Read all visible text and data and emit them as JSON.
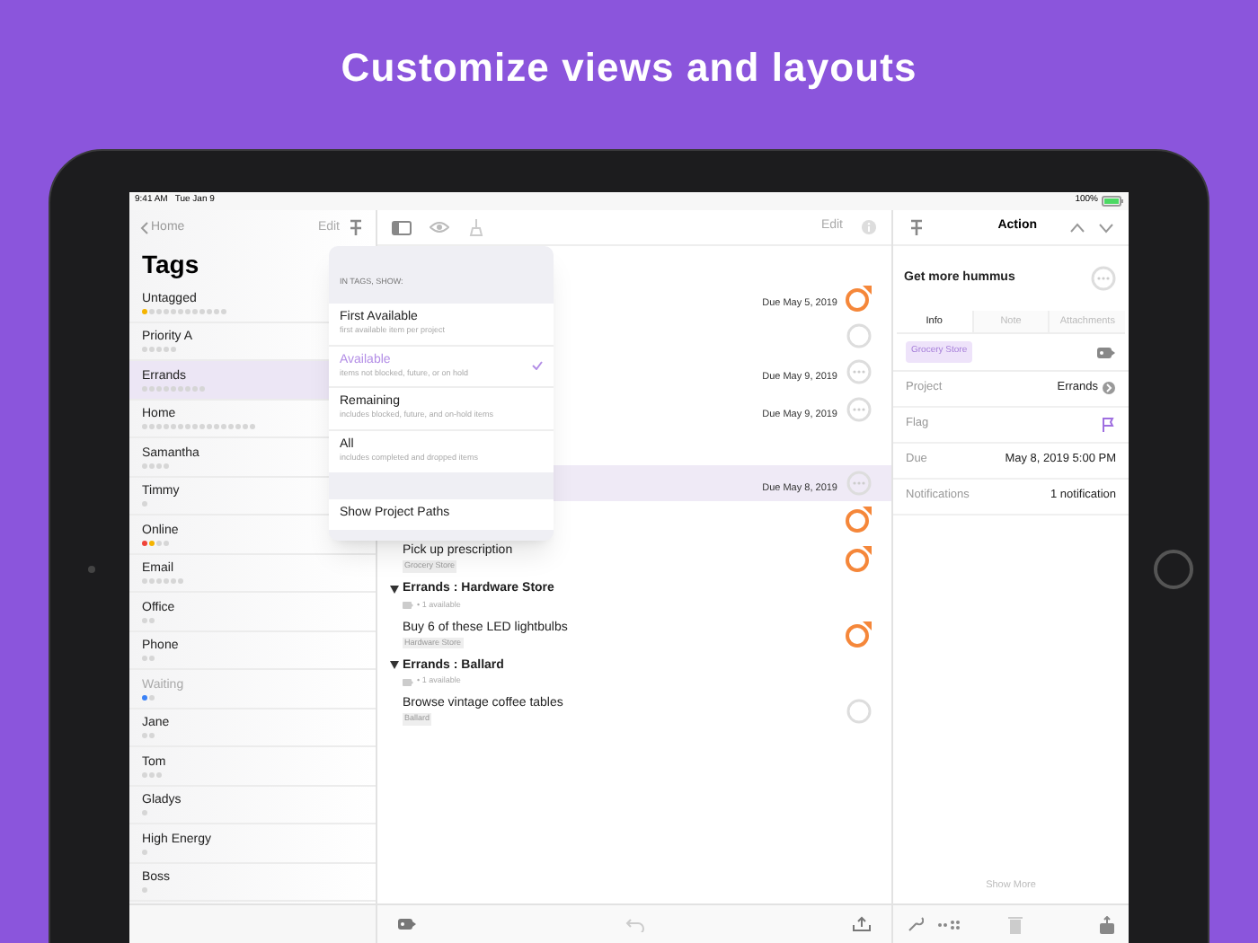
{
  "headline": "Customize views and layouts",
  "status_bar": {
    "time": "9:41 AM",
    "date": "Tue Jan 9",
    "battery": "100%"
  },
  "sidebar": {
    "back": "Home",
    "edit": "Edit",
    "title": "Tags",
    "tags": [
      {
        "name": "Untagged",
        "selected": false,
        "dimmed": false,
        "dots": [
          {
            "color": "#f5b400"
          },
          {
            "color": "#d6d6d6"
          },
          {
            "color": "#d6d6d6"
          },
          {
            "color": "#d6d6d6"
          },
          {
            "color": "#d6d6d6"
          },
          {
            "color": "#d6d6d6"
          },
          {
            "color": "#d6d6d6"
          },
          {
            "color": "#d6d6d6"
          },
          {
            "color": "#d6d6d6"
          },
          {
            "color": "#d6d6d6"
          },
          {
            "color": "#d6d6d6"
          },
          {
            "color": "#d6d6d6"
          }
        ]
      },
      {
        "name": "Priority A",
        "selected": false,
        "dimmed": false,
        "dots": [
          {
            "color": "#d6d6d6"
          },
          {
            "color": "#d6d6d6"
          },
          {
            "color": "#d6d6d6"
          },
          {
            "color": "#d6d6d6"
          },
          {
            "color": "#d6d6d6"
          }
        ]
      },
      {
        "name": "Errands",
        "selected": true,
        "dimmed": false,
        "dots": [
          {
            "color": "#d6d6d6"
          },
          {
            "color": "#d6d6d6"
          },
          {
            "color": "#d6d6d6"
          },
          {
            "color": "#d6d6d6"
          },
          {
            "color": "#d6d6d6"
          },
          {
            "color": "#d6d6d6"
          },
          {
            "color": "#d6d6d6"
          },
          {
            "color": "#d6d6d6"
          },
          {
            "color": "#d6d6d6"
          }
        ]
      },
      {
        "name": "Home",
        "selected": false,
        "dimmed": false,
        "dots": [
          {
            "color": "#d6d6d6"
          },
          {
            "color": "#d6d6d6"
          },
          {
            "color": "#d6d6d6"
          },
          {
            "color": "#d6d6d6"
          },
          {
            "color": "#d6d6d6"
          },
          {
            "color": "#d6d6d6"
          },
          {
            "color": "#d6d6d6"
          },
          {
            "color": "#d6d6d6"
          },
          {
            "color": "#d6d6d6"
          },
          {
            "color": "#d6d6d6"
          },
          {
            "color": "#d6d6d6"
          },
          {
            "color": "#d6d6d6"
          },
          {
            "color": "#d6d6d6"
          },
          {
            "color": "#d6d6d6"
          },
          {
            "color": "#d6d6d6"
          },
          {
            "color": "#d6d6d6"
          }
        ]
      },
      {
        "name": "Samantha",
        "selected": false,
        "dimmed": false,
        "dots": [
          {
            "color": "#d6d6d6"
          },
          {
            "color": "#d6d6d6"
          },
          {
            "color": "#d6d6d6"
          },
          {
            "color": "#d6d6d6"
          }
        ]
      },
      {
        "name": "Timmy",
        "selected": false,
        "dimmed": false,
        "dots": [
          {
            "color": "#d6d6d6"
          }
        ]
      },
      {
        "name": "Online",
        "selected": false,
        "dimmed": false,
        "dots": [
          {
            "color": "#f0443a"
          },
          {
            "color": "#f5b400"
          },
          {
            "color": "#d6d6d6"
          },
          {
            "color": "#d6d6d6"
          }
        ]
      },
      {
        "name": "Email",
        "selected": false,
        "dimmed": false,
        "dots": [
          {
            "color": "#d6d6d6"
          },
          {
            "color": "#d6d6d6"
          },
          {
            "color": "#d6d6d6"
          },
          {
            "color": "#d6d6d6"
          },
          {
            "color": "#d6d6d6"
          },
          {
            "color": "#d6d6d6"
          }
        ]
      },
      {
        "name": "Office",
        "selected": false,
        "dimmed": false,
        "dots": [
          {
            "color": "#d6d6d6"
          },
          {
            "color": "#d6d6d6"
          }
        ]
      },
      {
        "name": "Phone",
        "selected": false,
        "dimmed": false,
        "dots": [
          {
            "color": "#d6d6d6"
          },
          {
            "color": "#d6d6d6"
          }
        ]
      },
      {
        "name": "Waiting",
        "selected": false,
        "dimmed": true,
        "dots": [
          {
            "color": "#3b82f6"
          },
          {
            "color": "#d6d6d6"
          }
        ]
      },
      {
        "name": "Jane",
        "selected": false,
        "dimmed": false,
        "dots": [
          {
            "color": "#d6d6d6"
          },
          {
            "color": "#d6d6d6"
          }
        ]
      },
      {
        "name": "Tom",
        "selected": false,
        "dimmed": false,
        "dots": [
          {
            "color": "#d6d6d6"
          },
          {
            "color": "#d6d6d6"
          },
          {
            "color": "#d6d6d6"
          }
        ]
      },
      {
        "name": "Gladys",
        "selected": false,
        "dimmed": false,
        "dots": [
          {
            "color": "#d6d6d6"
          }
        ]
      },
      {
        "name": "High Energy",
        "selected": false,
        "dimmed": false,
        "dots": [
          {
            "color": "#d6d6d6"
          }
        ]
      },
      {
        "name": "Boss",
        "selected": false,
        "dimmed": false,
        "dots": [
          {
            "color": "#d6d6d6"
          }
        ]
      }
    ]
  },
  "main": {
    "edit": "Edit",
    "rows": [
      {
        "kind": "task",
        "selected": false,
        "flagged": true,
        "due": "Due May 5, 2019"
      },
      {
        "kind": "task",
        "selected": false,
        "flagged": false,
        "ellipsis": false
      },
      {
        "kind": "task",
        "selected": false,
        "flagged": false,
        "ellipsis": true,
        "due": "Due May 9, 2019"
      },
      {
        "kind": "task",
        "selected": false,
        "flagged": false,
        "ellipsis": true,
        "due": "Due May 9, 2019"
      },
      {
        "kind": "header"
      },
      {
        "kind": "task",
        "selected": true,
        "flagged": false,
        "ellipsis": true,
        "due": "Due May 8, 2019"
      },
      {
        "kind": "task",
        "selected": false,
        "flagged": true
      },
      {
        "kind": "task",
        "selected": false,
        "flagged": true,
        "title": "Pick up prescription",
        "tag": "Grocery Store"
      },
      {
        "kind": "header",
        "title": "Errands : Hardware Store",
        "subtitle": "• 1 available"
      },
      {
        "kind": "task",
        "selected": false,
        "flagged": true,
        "title": "Buy 6 of these LED lightbulbs",
        "tag": "Hardware Store"
      },
      {
        "kind": "header",
        "title": "Errands : Ballard",
        "subtitle": "• 1 available"
      },
      {
        "kind": "task",
        "selected": false,
        "flagged": false,
        "ellipsis": false,
        "title": "Browse vintage coffee tables",
        "tag": "Ballard"
      }
    ]
  },
  "popover": {
    "heading": "IN TAGS, SHOW:",
    "options": [
      {
        "title": "First Available",
        "subtitle": "first available item per project",
        "selected": false
      },
      {
        "title": "Available",
        "subtitle": "items not blocked, future, or on hold",
        "selected": true
      },
      {
        "title": "Remaining",
        "subtitle": "includes blocked, future, and on-hold items",
        "selected": false
      },
      {
        "title": "All",
        "subtitle": "includes completed and dropped items",
        "selected": false
      }
    ],
    "toggle": "Show Project Paths"
  },
  "inspector": {
    "title": "Action",
    "item": "Get more hummus",
    "tabs": [
      {
        "label": "Info",
        "selected": true
      },
      {
        "label": "Note",
        "selected": false
      },
      {
        "label": "Attachments",
        "selected": false
      }
    ],
    "tag": "Grocery Store",
    "fields": [
      {
        "kind": "link",
        "label": "Project",
        "value": "Errands"
      },
      {
        "kind": "flag",
        "label": "Flag"
      },
      {
        "kind": "text",
        "label": "Due",
        "value": "May 8, 2019  5:00 PM"
      },
      {
        "kind": "text",
        "label": "Notifications",
        "value": "1 notification"
      }
    ],
    "show_more": "Show More"
  }
}
